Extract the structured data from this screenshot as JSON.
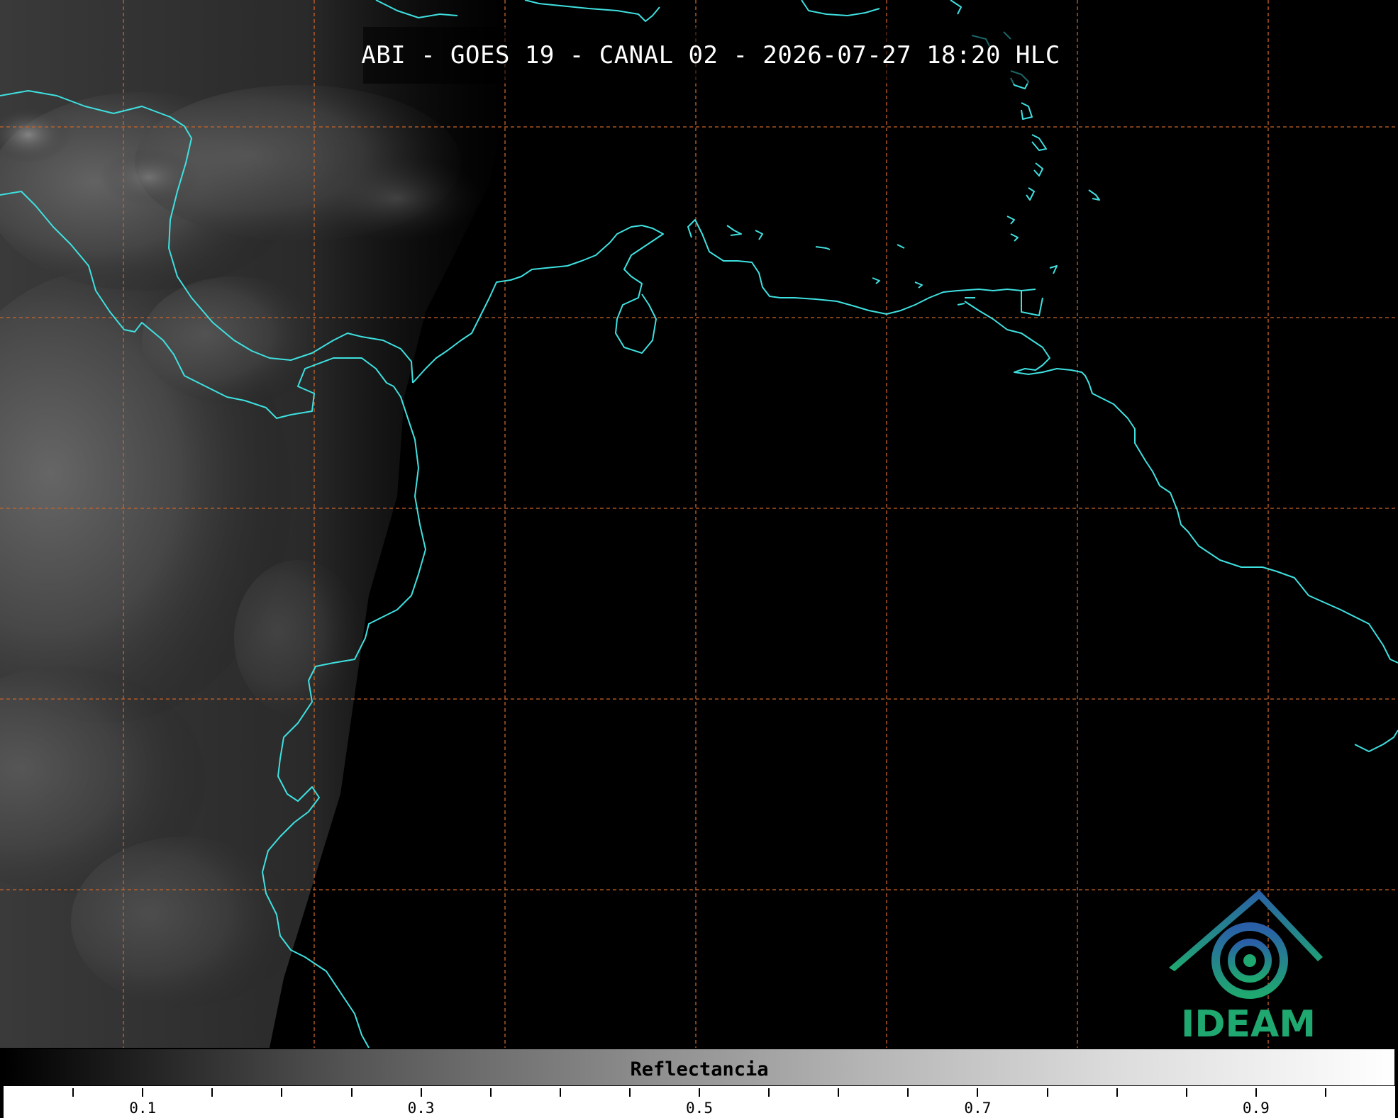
{
  "title": "ABI - GOES 19 - CANAL 02 - 2026-07-27 18:20 HLC",
  "colorbar": {
    "label": "Reflectancia",
    "range": [
      0.0,
      1.0
    ],
    "tick_labels": [
      "0.1",
      "0.3",
      "0.5",
      "0.7",
      "0.9"
    ],
    "tick_values": [
      0.1,
      0.3,
      0.5,
      0.7,
      0.9
    ],
    "minor_tick_values": [
      0.05,
      0.15,
      0.2,
      0.25,
      0.35,
      0.4,
      0.45,
      0.55,
      0.6,
      0.65,
      0.75,
      0.8,
      0.85,
      0.95
    ],
    "colors": [
      "#000000",
      "#ffffff"
    ]
  },
  "logo": {
    "text": "IDEAM",
    "colors": [
      "#2a5fa8",
      "#1fa870"
    ]
  },
  "map": {
    "coastline_color": "#3fe0e0",
    "grid_color": "#c8642a",
    "background": "#000000"
  }
}
